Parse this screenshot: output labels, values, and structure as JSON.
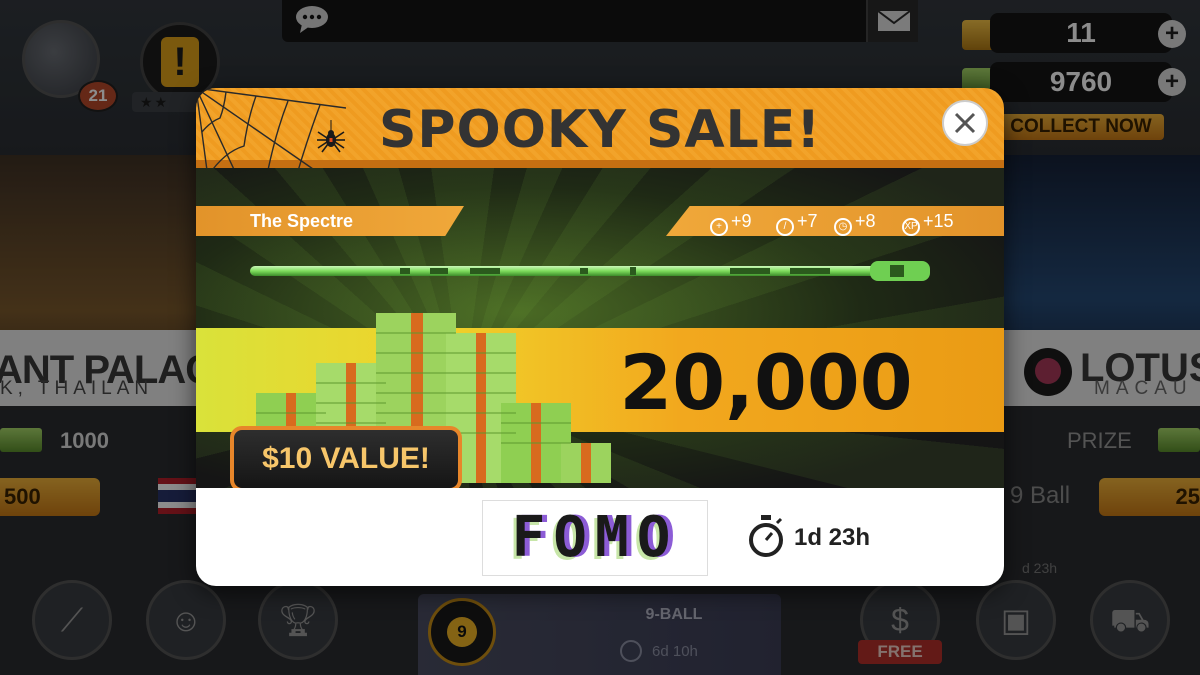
{
  "lobby": {
    "player": {
      "level": "21"
    },
    "currency": {
      "gold": "11",
      "cash": "9760",
      "collect_label": "COLLECT NOW"
    },
    "venues": {
      "left": {
        "name": "ANT PALACE",
        "location": "K, THAILAN",
        "prize": "1000",
        "entry": "500"
      },
      "right": {
        "name": "LOTUS",
        "location": "MACAU",
        "prize_label": "PRIZE",
        "game": "9 Ball",
        "entry": "25",
        "timer": "d 23h"
      }
    },
    "event_card": {
      "title": "9-BALL",
      "ball_number": "9",
      "time_left": "6d 10h"
    },
    "nav": {
      "free_label": "FREE"
    }
  },
  "modal": {
    "title": "SPOOKY SALE!",
    "cue_name": "The Spectre",
    "stats": [
      {
        "icon": "aim-icon",
        "value": "+9"
      },
      {
        "icon": "force-icon",
        "value": "+7"
      },
      {
        "icon": "time-icon",
        "value": "+8"
      },
      {
        "icon": "xp-icon",
        "value": "+15"
      }
    ],
    "amount": "20,000",
    "value_label": "$10 VALUE!",
    "buy_label": "FOMO",
    "time_left": "1d 23h"
  },
  "colors": {
    "header_orange": "#f2a32a",
    "accent_yellow": "#f0d22a",
    "badge_border": "#e7862a",
    "fomo_purple": "#8c5cd6",
    "fomo_green": "#c7e6a8"
  }
}
